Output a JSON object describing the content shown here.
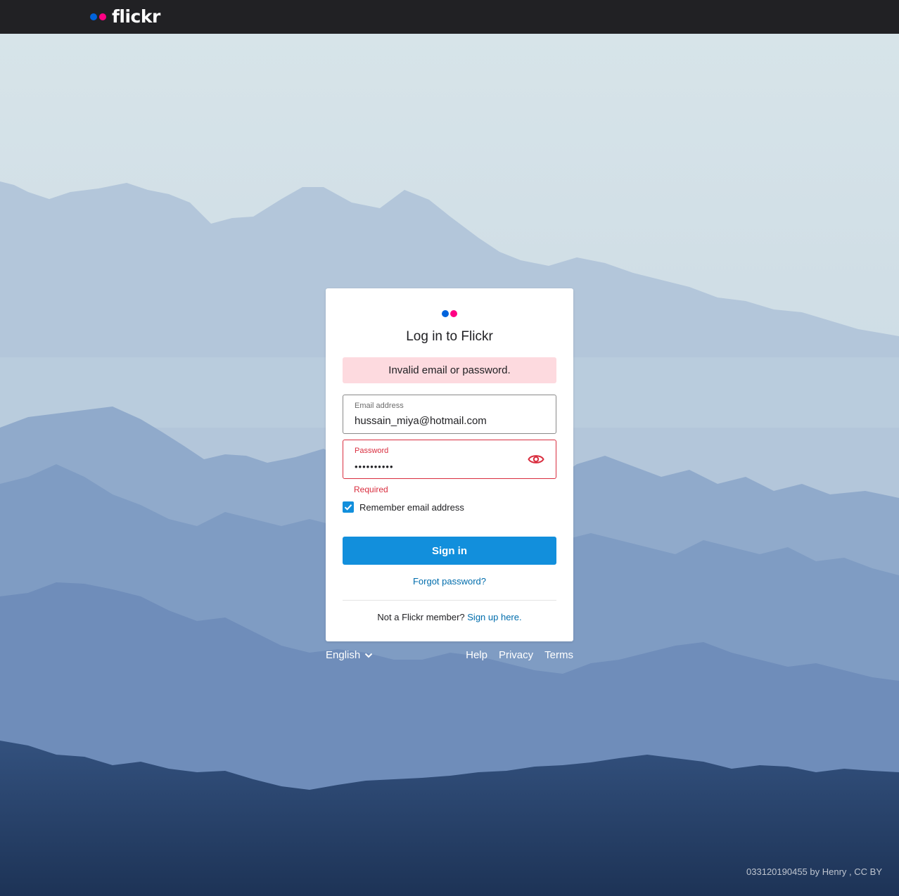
{
  "header": {
    "logo_text": "flickr",
    "brand_colors": {
      "blue": "#0063dc",
      "pink": "#ff0084"
    }
  },
  "card": {
    "title": "Log in to Flickr",
    "error_message": "Invalid email or password.",
    "email": {
      "label": "Email address",
      "value": "hussain_miya@hotmail.com"
    },
    "password": {
      "label": "Password",
      "value": "••••••••••",
      "error": "Required",
      "toggle_icon": "eye-icon"
    },
    "remember": {
      "label": "Remember email address",
      "checked": true
    },
    "signin_label": "Sign in",
    "forgot_label": "Forgot password?",
    "signup_prompt": "Not a Flickr member?",
    "signup_link": "Sign up here."
  },
  "footer": {
    "language": "English",
    "links": [
      "Help",
      "Privacy",
      "Terms"
    ]
  },
  "photo_credit": "033120190455 by Henry , CC BY",
  "colors": {
    "primary_button": "#128fdc",
    "error": "#d92e3f",
    "error_bg": "#fddadf",
    "link": "#006dac",
    "topbar": "#212124"
  }
}
